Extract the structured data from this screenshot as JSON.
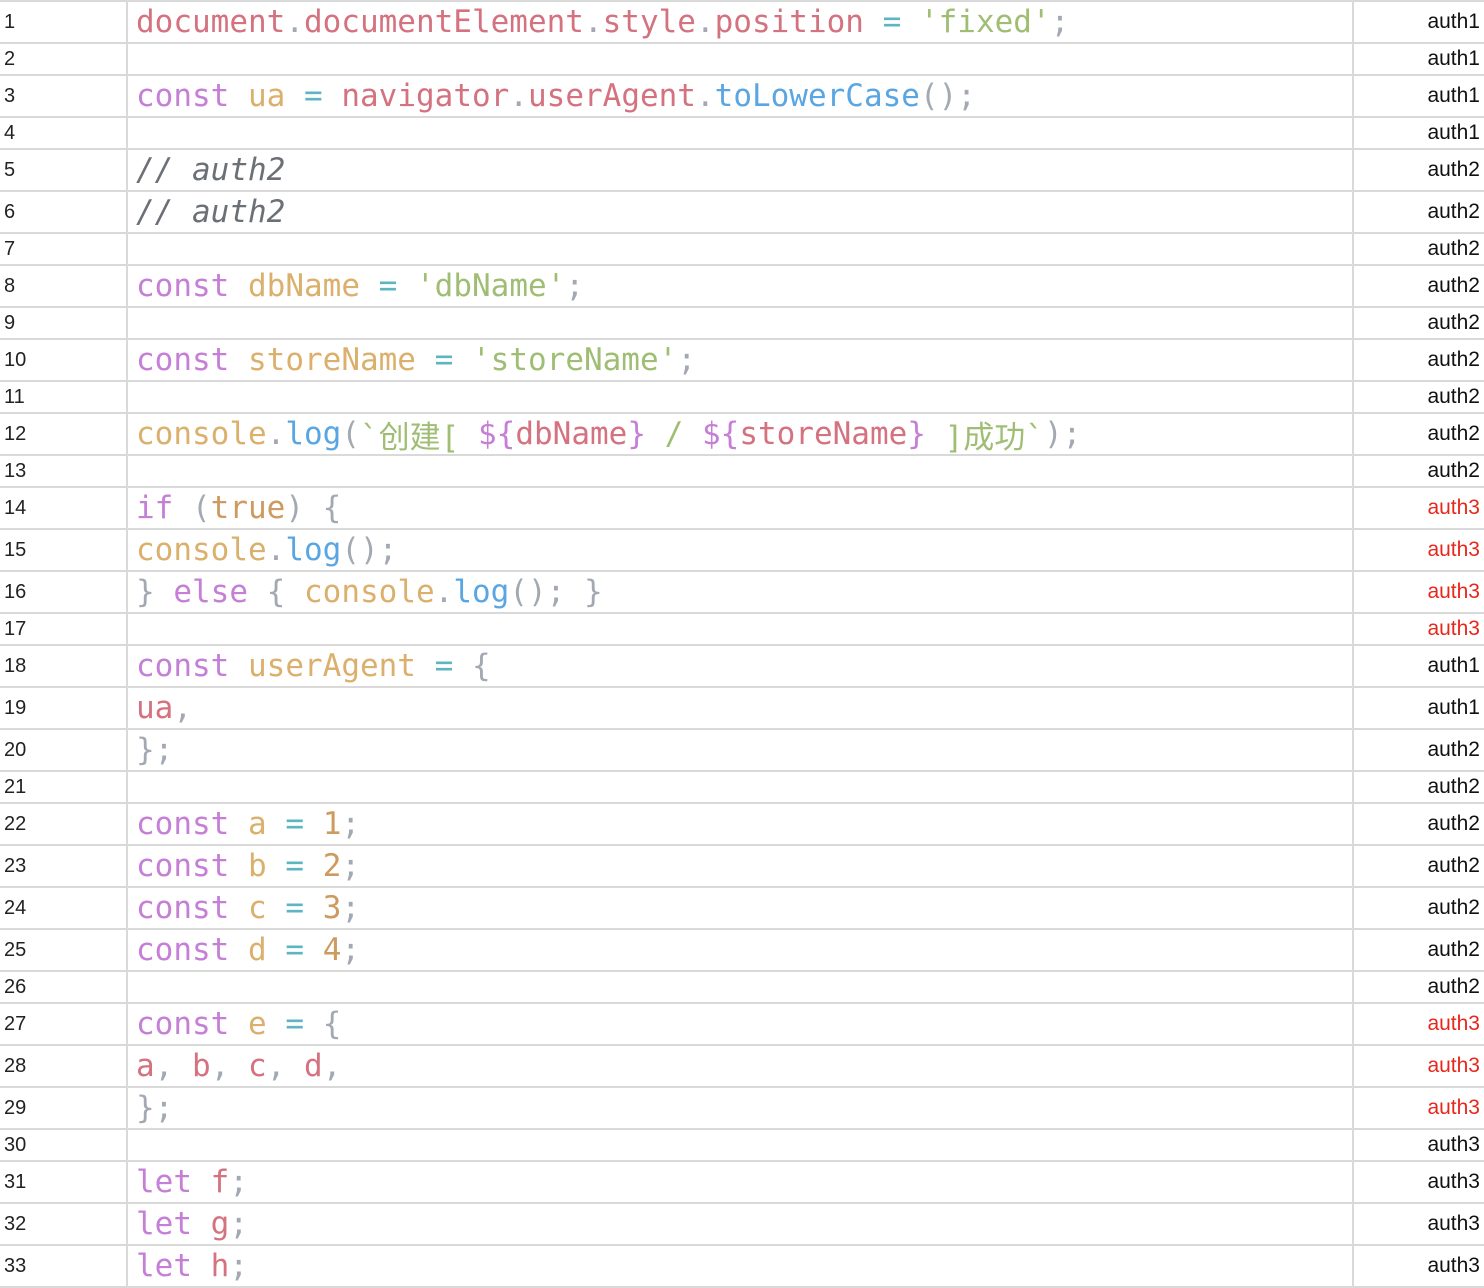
{
  "colors": {
    "grid_line": "#d9d9d9",
    "author_highlight": "#e8271c",
    "keyword": "#c57fd6",
    "variable": "#d4727f",
    "declared_name": "#dbb06c",
    "operator": "#5cb6c2",
    "string": "#9fbe74",
    "function": "#5aa6e3",
    "number": "#cd9a5f",
    "punctuation": "#a2a9b3",
    "comment": "#6b6f76"
  },
  "rows": [
    {
      "line": "1",
      "author": "auth1",
      "highlight": false,
      "tokens": [
        [
          "var",
          "document"
        ],
        [
          "punct",
          "."
        ],
        [
          "var",
          "documentElement"
        ],
        [
          "punct",
          "."
        ],
        [
          "var",
          "style"
        ],
        [
          "punct",
          "."
        ],
        [
          "var",
          "position"
        ],
        [
          "plain",
          " "
        ],
        [
          "op",
          "="
        ],
        [
          "plain",
          " "
        ],
        [
          "str",
          "'fixed'"
        ],
        [
          "punct",
          ";"
        ]
      ]
    },
    {
      "line": "2",
      "author": "auth1",
      "highlight": false,
      "tokens": []
    },
    {
      "line": "3",
      "author": "auth1",
      "highlight": false,
      "tokens": [
        [
          "kw",
          "const"
        ],
        [
          "plain",
          " "
        ],
        [
          "decl",
          "ua"
        ],
        [
          "plain",
          " "
        ],
        [
          "op",
          "="
        ],
        [
          "plain",
          " "
        ],
        [
          "var",
          "navigator"
        ],
        [
          "punct",
          "."
        ],
        [
          "var",
          "userAgent"
        ],
        [
          "punct",
          "."
        ],
        [
          "fn",
          "toLowerCase"
        ],
        [
          "punct",
          "();"
        ]
      ]
    },
    {
      "line": "4",
      "author": "auth1",
      "highlight": false,
      "tokens": []
    },
    {
      "line": "5",
      "author": "auth2",
      "highlight": false,
      "tokens": [
        [
          "comment",
          "// auth2"
        ]
      ]
    },
    {
      "line": "6",
      "author": "auth2",
      "highlight": false,
      "tokens": [
        [
          "comment",
          "// auth2"
        ]
      ]
    },
    {
      "line": "7",
      "author": "auth2",
      "highlight": false,
      "tokens": []
    },
    {
      "line": "8",
      "author": "auth2",
      "highlight": false,
      "tokens": [
        [
          "kw",
          "const"
        ],
        [
          "plain",
          " "
        ],
        [
          "decl",
          "dbName"
        ],
        [
          "plain",
          " "
        ],
        [
          "op",
          "="
        ],
        [
          "plain",
          " "
        ],
        [
          "str",
          "'dbName'"
        ],
        [
          "punct",
          ";"
        ]
      ]
    },
    {
      "line": "9",
      "author": "auth2",
      "highlight": false,
      "tokens": []
    },
    {
      "line": "10",
      "author": "auth2",
      "highlight": false,
      "tokens": [
        [
          "kw",
          "const"
        ],
        [
          "plain",
          " "
        ],
        [
          "decl",
          "storeName"
        ],
        [
          "plain",
          " "
        ],
        [
          "op",
          "="
        ],
        [
          "plain",
          " "
        ],
        [
          "str",
          "'storeName'"
        ],
        [
          "punct",
          ";"
        ]
      ]
    },
    {
      "line": "11",
      "author": "auth2",
      "highlight": false,
      "tokens": []
    },
    {
      "line": "12",
      "author": "auth2",
      "highlight": false,
      "tokens": [
        [
          "decl",
          "console"
        ],
        [
          "punct",
          "."
        ],
        [
          "fn",
          "log"
        ],
        [
          "punct",
          "("
        ],
        [
          "str",
          "`创建[ "
        ],
        [
          "kw",
          "${"
        ],
        [
          "var",
          "dbName"
        ],
        [
          "kw",
          "}"
        ],
        [
          "str",
          " / "
        ],
        [
          "kw",
          "${"
        ],
        [
          "var",
          "storeName"
        ],
        [
          "kw",
          "}"
        ],
        [
          "str",
          " ]成功`"
        ],
        [
          "punct",
          ");"
        ]
      ]
    },
    {
      "line": "13",
      "author": "auth2",
      "highlight": false,
      "tokens": []
    },
    {
      "line": "14",
      "author": "auth3",
      "highlight": true,
      "tokens": [
        [
          "kw",
          "if"
        ],
        [
          "plain",
          " "
        ],
        [
          "punct",
          "("
        ],
        [
          "num",
          "true"
        ],
        [
          "punct",
          ")"
        ],
        [
          "plain",
          " "
        ],
        [
          "punct",
          "{"
        ]
      ]
    },
    {
      "line": "15",
      "author": "auth3",
      "highlight": true,
      "tokens": [
        [
          "decl",
          "console"
        ],
        [
          "punct",
          "."
        ],
        [
          "fn",
          "log"
        ],
        [
          "punct",
          "();"
        ]
      ]
    },
    {
      "line": "16",
      "author": "auth3",
      "highlight": true,
      "tokens": [
        [
          "punct",
          "}"
        ],
        [
          "plain",
          " "
        ],
        [
          "kw",
          "else"
        ],
        [
          "plain",
          " "
        ],
        [
          "punct",
          "{"
        ],
        [
          "plain",
          " "
        ],
        [
          "decl",
          "console"
        ],
        [
          "punct",
          "."
        ],
        [
          "fn",
          "log"
        ],
        [
          "punct",
          "();"
        ],
        [
          "plain",
          " "
        ],
        [
          "punct",
          "}"
        ]
      ]
    },
    {
      "line": "17",
      "author": "auth3",
      "highlight": true,
      "tokens": []
    },
    {
      "line": "18",
      "author": "auth1",
      "highlight": false,
      "tokens": [
        [
          "kw",
          "const"
        ],
        [
          "plain",
          " "
        ],
        [
          "decl",
          "userAgent"
        ],
        [
          "plain",
          " "
        ],
        [
          "op",
          "="
        ],
        [
          "plain",
          " "
        ],
        [
          "punct",
          "{"
        ]
      ]
    },
    {
      "line": "19",
      "author": "auth1",
      "highlight": false,
      "tokens": [
        [
          "var",
          "ua"
        ],
        [
          "punct",
          ","
        ]
      ]
    },
    {
      "line": "20",
      "author": "auth2",
      "highlight": false,
      "tokens": [
        [
          "punct",
          "};"
        ]
      ]
    },
    {
      "line": "21",
      "author": "auth2",
      "highlight": false,
      "tokens": []
    },
    {
      "line": "22",
      "author": "auth2",
      "highlight": false,
      "tokens": [
        [
          "kw",
          "const"
        ],
        [
          "plain",
          " "
        ],
        [
          "decl",
          "a"
        ],
        [
          "plain",
          " "
        ],
        [
          "op",
          "="
        ],
        [
          "plain",
          " "
        ],
        [
          "num",
          "1"
        ],
        [
          "punct",
          ";"
        ]
      ]
    },
    {
      "line": "23",
      "author": "auth2",
      "highlight": false,
      "tokens": [
        [
          "kw",
          "const"
        ],
        [
          "plain",
          " "
        ],
        [
          "decl",
          "b"
        ],
        [
          "plain",
          " "
        ],
        [
          "op",
          "="
        ],
        [
          "plain",
          " "
        ],
        [
          "num",
          "2"
        ],
        [
          "punct",
          ";"
        ]
      ]
    },
    {
      "line": "24",
      "author": "auth2",
      "highlight": false,
      "tokens": [
        [
          "kw",
          "const"
        ],
        [
          "plain",
          " "
        ],
        [
          "decl",
          "c"
        ],
        [
          "plain",
          " "
        ],
        [
          "op",
          "="
        ],
        [
          "plain",
          " "
        ],
        [
          "num",
          "3"
        ],
        [
          "punct",
          ";"
        ]
      ]
    },
    {
      "line": "25",
      "author": "auth2",
      "highlight": false,
      "tokens": [
        [
          "kw",
          "const"
        ],
        [
          "plain",
          " "
        ],
        [
          "decl",
          "d"
        ],
        [
          "plain",
          " "
        ],
        [
          "op",
          "="
        ],
        [
          "plain",
          " "
        ],
        [
          "num",
          "4"
        ],
        [
          "punct",
          ";"
        ]
      ]
    },
    {
      "line": "26",
      "author": "auth2",
      "highlight": false,
      "tokens": []
    },
    {
      "line": "27",
      "author": "auth3",
      "highlight": true,
      "tokens": [
        [
          "kw",
          "const"
        ],
        [
          "plain",
          " "
        ],
        [
          "decl",
          "e"
        ],
        [
          "plain",
          " "
        ],
        [
          "op",
          "="
        ],
        [
          "plain",
          " "
        ],
        [
          "punct",
          "{"
        ]
      ]
    },
    {
      "line": "28",
      "author": "auth3",
      "highlight": true,
      "tokens": [
        [
          "var",
          "a"
        ],
        [
          "punct",
          ","
        ],
        [
          "plain",
          " "
        ],
        [
          "var",
          "b"
        ],
        [
          "punct",
          ","
        ],
        [
          "plain",
          " "
        ],
        [
          "var",
          "c"
        ],
        [
          "punct",
          ","
        ],
        [
          "plain",
          " "
        ],
        [
          "var",
          "d"
        ],
        [
          "punct",
          ","
        ]
      ]
    },
    {
      "line": "29",
      "author": "auth3",
      "highlight": true,
      "tokens": [
        [
          "punct",
          "};"
        ]
      ]
    },
    {
      "line": "30",
      "author": "auth3",
      "highlight": false,
      "tokens": []
    },
    {
      "line": "31",
      "author": "auth3",
      "highlight": false,
      "tokens": [
        [
          "kw",
          "let"
        ],
        [
          "plain",
          " "
        ],
        [
          "var",
          "f"
        ],
        [
          "punct",
          ";"
        ]
      ]
    },
    {
      "line": "32",
      "author": "auth3",
      "highlight": false,
      "tokens": [
        [
          "kw",
          "let"
        ],
        [
          "plain",
          " "
        ],
        [
          "var",
          "g"
        ],
        [
          "punct",
          ";"
        ]
      ]
    },
    {
      "line": "33",
      "author": "auth3",
      "highlight": false,
      "tokens": [
        [
          "kw",
          "let"
        ],
        [
          "plain",
          " "
        ],
        [
          "var",
          "h"
        ],
        [
          "punct",
          ";"
        ]
      ]
    }
  ]
}
